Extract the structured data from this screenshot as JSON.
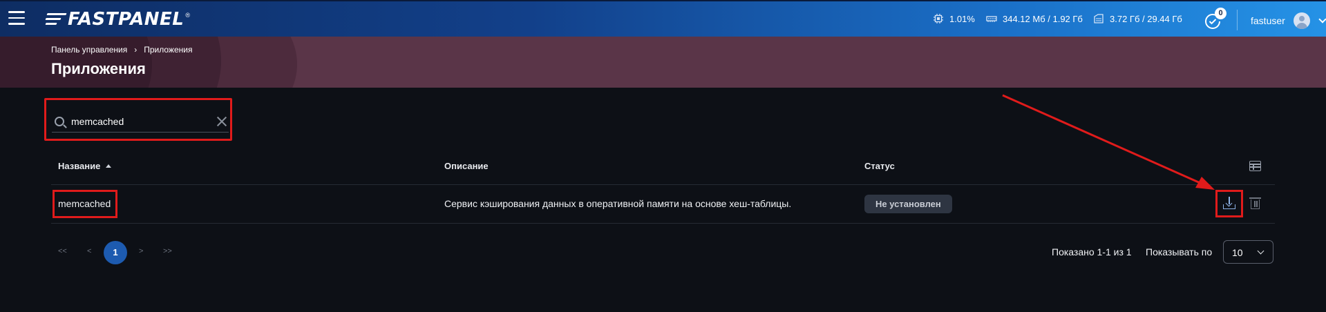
{
  "app": {
    "logo_text": "FASTPANEL",
    "logo_reg": "®"
  },
  "topbar": {
    "cpu": "1.01%",
    "ram": "344.12 Мб / 1.92 Гб",
    "disk": "3.72 Гб / 29.44 Гб",
    "notifications_count": "0",
    "username": "fastuser"
  },
  "breadcrumb": {
    "root": "Панель управления",
    "separator": "›",
    "current": "Приложения"
  },
  "page": {
    "title": "Приложения"
  },
  "search": {
    "value": "memcached"
  },
  "table": {
    "columns": [
      "Название",
      "Описание",
      "Статус"
    ],
    "rows": [
      {
        "name": "memcached",
        "description": "Сервис кэширования данных в оперативной памяти на основе хеш-таблицы.",
        "status": "Не установлен"
      }
    ]
  },
  "pagination": {
    "first": "<<",
    "prev": "<",
    "current": "1",
    "next": ">",
    "last": ">>",
    "shown_text": "Показано 1-1 из 1",
    "per_page_label": "Показывать по",
    "per_page_value": "10"
  },
  "colors": {
    "annotation": "#e01b1b",
    "accent": "#1d5bb0"
  },
  "icons": {
    "menu": "hamburger-icon",
    "cpu": "cpu-icon",
    "ram": "ram-icon",
    "disk": "disk-icon",
    "notifications": "notifications-icon",
    "user": "avatar-icon",
    "search": "search-icon",
    "clear": "close-icon",
    "columns": "columns-settings-icon",
    "install": "install-icon",
    "delete": "trash-icon"
  }
}
